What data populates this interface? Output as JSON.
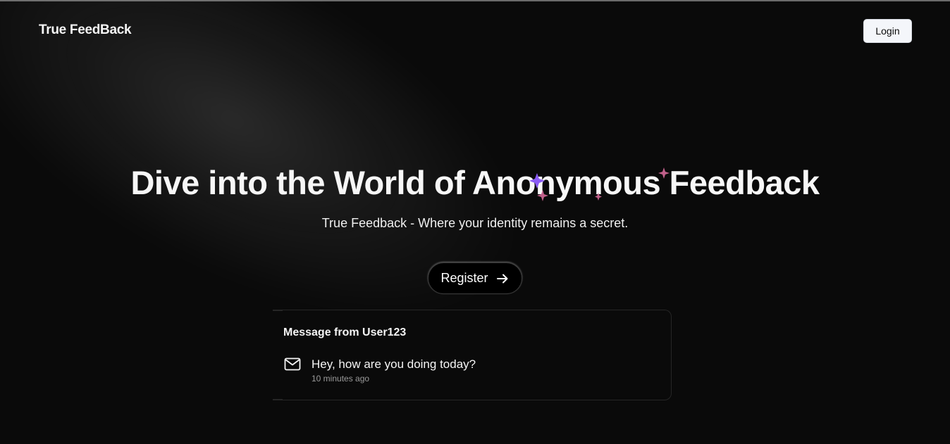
{
  "navbar": {
    "brand": "True FeedBack",
    "login_label": "Login"
  },
  "hero": {
    "title": "Dive into the World of Anonymous Feedback",
    "subtitle": "True Feedback - Where your identity remains a secret.",
    "register_label": "Register"
  },
  "message_card": {
    "title": "Message from User123",
    "message": "Hey, how are you doing today?",
    "time": "10 minutes ago"
  },
  "icons": {
    "register_arrow": "arrow-right-icon",
    "message": "mail-icon",
    "sparkle": "sparkle-icon"
  },
  "colors": {
    "background": "#0a0a0a",
    "login_button_bg": "#f4f6fa",
    "sparkle_purple": "#8b5cf6",
    "sparkle_pink": "#c0608a"
  }
}
